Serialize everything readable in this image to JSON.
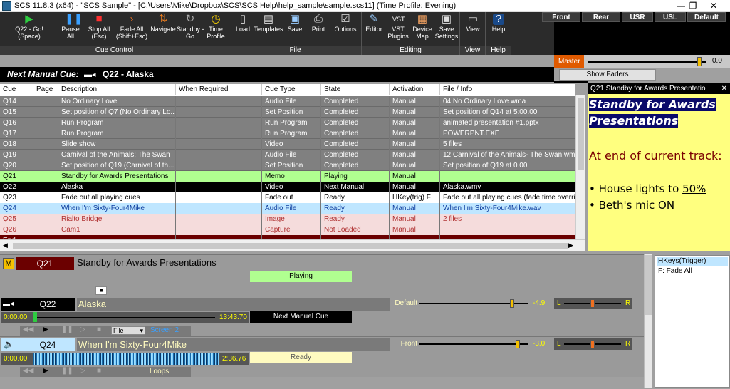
{
  "title_bar": {
    "title": "SCS 11.8.3 (x64) - \"SCS Sample\" - [C:\\Users\\Mike\\Dropbox\\SCS\\SCS Help\\help_sample\\sample.scs11] (Time Profile: Evening)",
    "min": "—",
    "max": "❐",
    "close": "✕"
  },
  "ribbon": {
    "cue_control": {
      "label": "Cue Control",
      "go": "Q22 - Go!\n(Space)",
      "pause": "Pause\nAll",
      "stop": "Stop All\n(Esc)",
      "fade": "Fade All\n(Shift+Esc)",
      "navigate": "Navigate",
      "standby": "Standby -\nGo",
      "time_profile": "Time\nProfile"
    },
    "file": {
      "label": "File",
      "load": "Load",
      "templates": "Templates",
      "save": "Save",
      "print": "Print",
      "options": "Options"
    },
    "editing": {
      "label": "Editing",
      "editor": "Editor",
      "vst": "VST\nPlugins",
      "device_map": "Device\nMap",
      "save_settings": "Save\nSettings"
    },
    "view": {
      "label": "View",
      "view": "View"
    },
    "help": {
      "label": "Help",
      "help": "Help"
    }
  },
  "speakers": [
    "Front",
    "Rear",
    "USR",
    "USL",
    "Default"
  ],
  "master": {
    "label": "Master",
    "value": "0.0",
    "level": 0.93
  },
  "show_faders": "Show Faders",
  "next_manual": {
    "label": "Next Manual Cue:",
    "value": "Q22 - Alaska"
  },
  "grid": {
    "columns": [
      "Cue",
      "Page",
      "Description",
      "When Required",
      "Cue Type",
      "State",
      "Activation",
      "File / Info"
    ],
    "rows": [
      {
        "cue": "Q14",
        "page": "",
        "desc": "No Ordinary Love",
        "when": "",
        "type": "Audio File",
        "state": "Completed",
        "act": "Manual",
        "file": "04 No Ordinary Love.wma",
        "style": "completed"
      },
      {
        "cue": "Q15",
        "page": "",
        "desc": "Set position of Q7 (No Ordinary Lo...",
        "when": "",
        "type": "Set Position",
        "state": "Completed",
        "act": "Manual",
        "file": "Set position of Q14 at 5:00.00",
        "style": "completed"
      },
      {
        "cue": "Q16",
        "page": "",
        "desc": "Run Program",
        "when": "",
        "type": "Run Program",
        "state": "Completed",
        "act": "Manual",
        "file": "animated presentation #1.pptx",
        "style": "completed"
      },
      {
        "cue": "Q17",
        "page": "",
        "desc": "Run Program",
        "when": "",
        "type": "Run Program",
        "state": "Completed",
        "act": "Manual",
        "file": "POWERPNT.EXE",
        "style": "completed"
      },
      {
        "cue": "Q18",
        "page": "",
        "desc": "Slide show",
        "when": "",
        "type": "Video",
        "state": "Completed",
        "act": "Manual",
        "file": "5 files",
        "style": "completed"
      },
      {
        "cue": "Q19",
        "page": "",
        "desc": "Carnival of the Animals: The Swan",
        "when": "",
        "type": "Audio File",
        "state": "Completed",
        "act": "Manual",
        "file": "12 Carnival of the Animals- The Swan.wma",
        "style": "completed"
      },
      {
        "cue": "Q20",
        "page": "",
        "desc": "Set position of Q19 (Carnival of th...",
        "when": "",
        "type": "Set Position",
        "state": "Completed",
        "act": "Manual",
        "file": "Set position of Q19 at 0.00",
        "style": "completed"
      },
      {
        "cue": "Q21",
        "page": "",
        "desc": "Standby for Awards Presentations",
        "when": "",
        "type": "Memo",
        "state": "Playing",
        "act": "Manual",
        "file": "",
        "style": "playing"
      },
      {
        "cue": "Q22",
        "page": "",
        "desc": "Alaska",
        "when": "",
        "type": "Video",
        "state": "Next Manual",
        "act": "Manual",
        "file": "Alaska.wmv",
        "style": "next"
      },
      {
        "cue": "Q23",
        "page": "",
        "desc": "Fade out all playing cues",
        "when": "",
        "type": "Fade out",
        "state": "Ready",
        "act": "HKey(trig) F",
        "file": "Fade out all playing cues  (fade time overri...",
        "style": "ready"
      },
      {
        "cue": "Q24",
        "page": "",
        "desc": "When I'm Sixty-Four4Mike",
        "when": "",
        "type": "Audio File",
        "state": "Ready",
        "act": "Manual",
        "file": "When I'm Sixty-Four4Mike.wav",
        "style": "audio"
      },
      {
        "cue": "Q25",
        "page": "",
        "desc": "Rialto Bridge",
        "when": "",
        "type": "Image",
        "state": "Ready",
        "act": "Manual",
        "file": "2 files",
        "style": "pink"
      },
      {
        "cue": "Q26",
        "page": "",
        "desc": "Cam1",
        "when": "",
        "type": "Capture",
        "state": "Not Loaded",
        "act": "Manual",
        "file": "",
        "style": "pink"
      },
      {
        "cue": "End",
        "page": "",
        "desc": "",
        "when": "",
        "type": "",
        "state": "",
        "act": "",
        "file": "",
        "style": "end"
      }
    ]
  },
  "memo": {
    "header": "Q21  Standby for Awards Presentatio",
    "title": "Standby for Awards Presentations",
    "line1": "At end of current track:",
    "bullet1_pre": "House lights to ",
    "bullet1_link": "50%",
    "bullet2": "Beth's mic ON"
  },
  "panels": {
    "q21": {
      "badge": "M",
      "cue": "Q21",
      "desc": "Standby for Awards Presentations",
      "state": "Playing"
    },
    "q22": {
      "cue": "Q22",
      "desc": "Alaska",
      "start": "0:00.00",
      "end": "13:43.70",
      "state": "Next Manual Cue",
      "device": "Default",
      "level": "-4.9",
      "l": "L",
      "r": "R",
      "file_sel": "File",
      "screen": "Screen 2",
      "progress": 0.0
    },
    "q24": {
      "cue": "Q24",
      "desc": "When I'm Sixty-Four4Mike",
      "start": "0:00.00",
      "end": "2:36.76",
      "state": "Ready",
      "device": "Front",
      "level": "-3.0",
      "l": "L",
      "r": "R",
      "loops": "Loops"
    }
  },
  "hotkeys": {
    "header": "HKeys(Trigger)",
    "items": [
      "F: Fade All"
    ]
  },
  "colors": {
    "completed": "#808080",
    "playing": "#b0ff90",
    "next": "#000000",
    "audio": "#bfe6ff",
    "pink": "#f5dcdc",
    "end": "#6b0000",
    "memo_bg": "#ffff7f",
    "master_orange": "#e05a00"
  }
}
